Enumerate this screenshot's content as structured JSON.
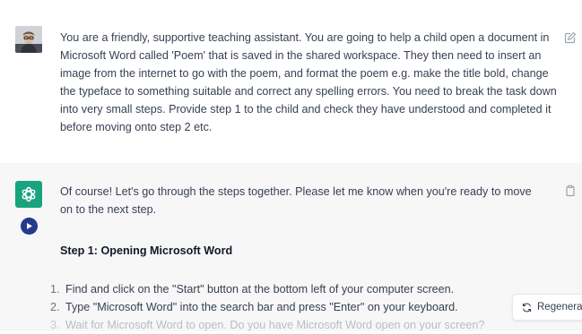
{
  "conversation": {
    "user_message": {
      "avatar_icon": "user-photo-avatar",
      "text": "You are a friendly, supportive teaching assistant. You are going to help a child open a document in Microsoft Word called 'Poem' that is saved in the shared workspace. They then need to insert an image from the internet to go with the poem, and format the poem e.g. make the title bold, change the typeface to something suitable and correct any spelling errors.  You need to break the task down into very small steps. Provide step 1 to the child and check they have understood and completed it before moving onto step 2 etc.",
      "edit_icon": "edit-icon"
    },
    "assistant_message": {
      "avatar_icon": "openai-logo-icon",
      "avatar_color": "#19a37f",
      "play_icon": "play-icon",
      "play_color": "#253a8c",
      "copy_icon": "clipboard-icon",
      "intro": "Of course! Let's go through the steps together. Please let me know when you're ready to move on to the next step.",
      "step_heading": "Step 1: Opening Microsoft Word",
      "steps": [
        {
          "num": "1.",
          "text": "Find and click on the \"Start\" button at the bottom left of your computer screen."
        },
        {
          "num": "2.",
          "text": "Type \"Microsoft Word\" into the search bar and press \"Enter\" on your keyboard."
        },
        {
          "num": "3.",
          "text": "Wait for Microsoft Word to open. Do you have Microsoft Word open on your screen?"
        }
      ]
    }
  },
  "regenerate": {
    "label": "Regenera",
    "icon": "refresh-icon"
  }
}
